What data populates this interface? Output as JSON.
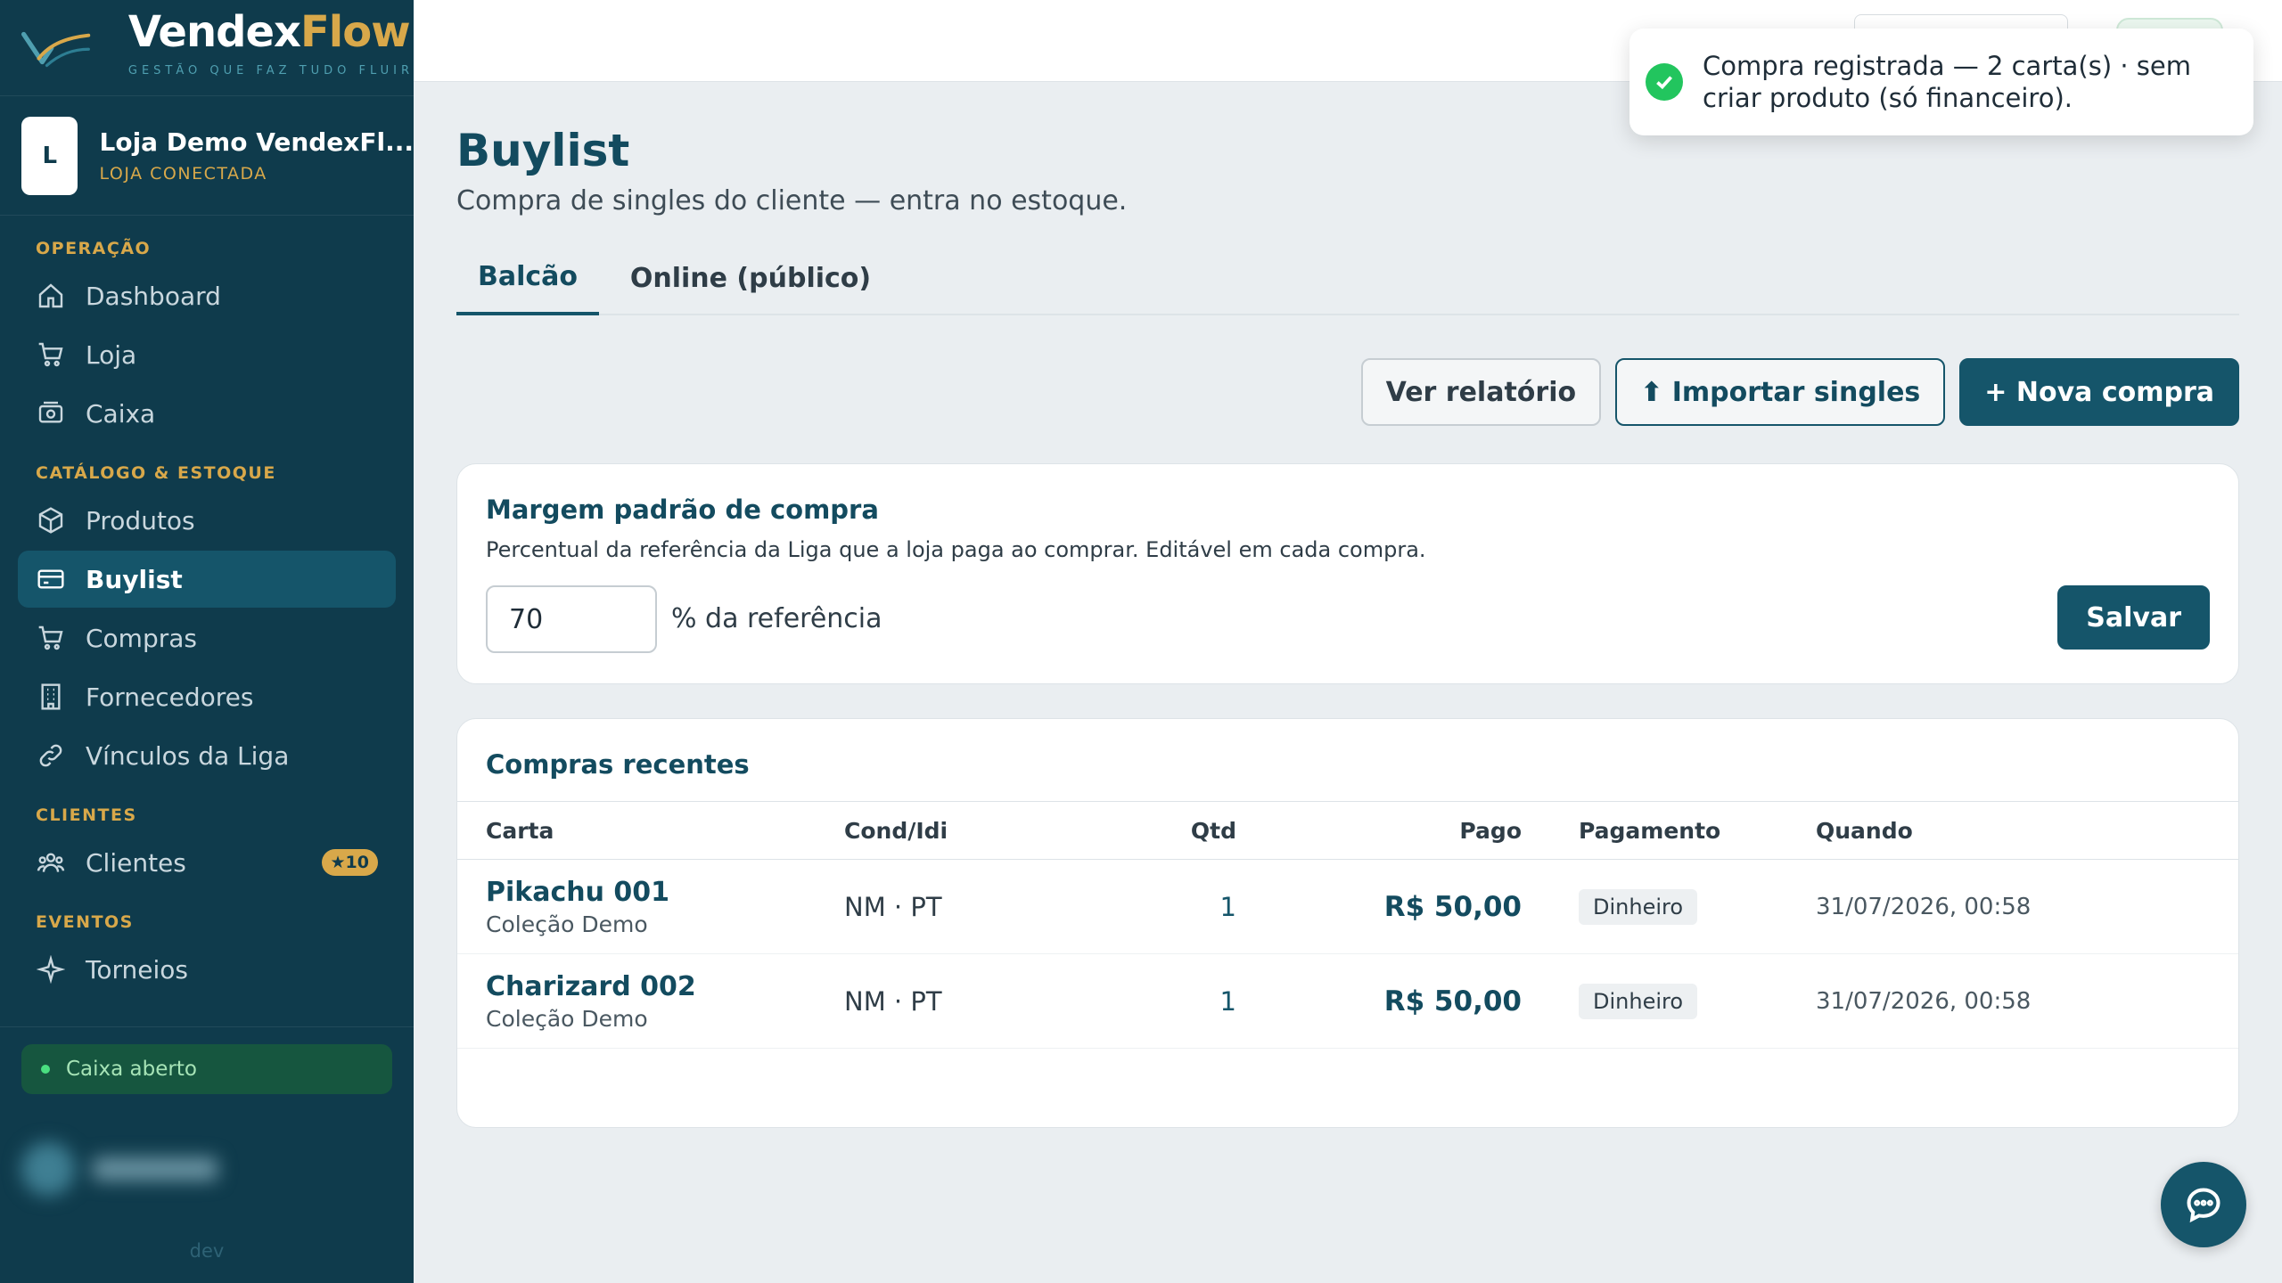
{
  "brand": {
    "name_part1": "Vendex",
    "name_part2": "Flow",
    "tagline": "GESTÃO QUE FAZ TUDO FLUIR",
    "colors": {
      "primary": "#0f3b4c",
      "accent": "#d8a84a",
      "teal": "#15556a",
      "success": "#22c55e"
    }
  },
  "store": {
    "avatar_letter": "L",
    "name": "Loja Demo VendexFl...",
    "status": "LOJA CONECTADA"
  },
  "sidebar": {
    "sections": [
      {
        "title": "OPERAÇÃO",
        "items": [
          {
            "label": "Dashboard",
            "icon": "home-icon"
          },
          {
            "label": "Loja",
            "icon": "cart-icon"
          },
          {
            "label": "Caixa",
            "icon": "cash-register-icon"
          }
        ]
      },
      {
        "title": "CATÁLOGO & ESTOQUE",
        "items": [
          {
            "label": "Produtos",
            "icon": "box-icon"
          },
          {
            "label": "Buylist",
            "icon": "card-icon",
            "active": true
          },
          {
            "label": "Compras",
            "icon": "cart-icon"
          },
          {
            "label": "Fornecedores",
            "icon": "building-icon"
          },
          {
            "label": "Vínculos da Liga",
            "icon": "link-icon"
          }
        ]
      },
      {
        "title": "CLIENTES",
        "items": [
          {
            "label": "Clientes",
            "icon": "users-icon",
            "badge": "★10"
          }
        ]
      },
      {
        "title": "EVENTOS",
        "items": [
          {
            "label": "Torneios",
            "icon": "sparkle-icon"
          }
        ]
      }
    ],
    "caixa_status": "Caixa aberto",
    "footer": "dev"
  },
  "page": {
    "title": "Buylist",
    "subtitle": "Compra de singles do cliente — entra no estoque.",
    "tabs": [
      {
        "label": "Balcão",
        "active": true
      },
      {
        "label": "Online (público)",
        "active": false
      }
    ],
    "actions": {
      "report": "Ver relatório",
      "import": "⬆ Importar singles",
      "new": "+ Nova compra"
    }
  },
  "margin": {
    "title": "Margem padrão de compra",
    "description": "Percentual da referência da Liga que a loja paga ao comprar. Editável em cada compra.",
    "value": "70",
    "suffix": "% da referência",
    "save": "Salvar"
  },
  "recent": {
    "title": "Compras recentes",
    "headers": {
      "card": "Carta",
      "cond": "Cond/Idi",
      "qtd": "Qtd",
      "pago": "Pago",
      "pagamento": "Pagamento",
      "quando": "Quando"
    },
    "rows": [
      {
        "name": "Pikachu 001",
        "set": "Coleção Demo",
        "cond": "NM · PT",
        "qtd": "1",
        "pago": "R$ 50,00",
        "pagamento": "Dinheiro",
        "quando": "31/07/2026, 00:58"
      },
      {
        "name": "Charizard 002",
        "set": "Coleção Demo",
        "cond": "NM · PT",
        "qtd": "1",
        "pago": "R$ 50,00",
        "pagamento": "Dinheiro",
        "quando": "31/07/2026, 00:58"
      }
    ]
  },
  "toast": {
    "message": "Compra registrada — 2 carta(s) · sem criar produto (só financeiro).",
    "icon": "check-circle-icon"
  },
  "chat": {
    "icon": "chat-icon"
  }
}
